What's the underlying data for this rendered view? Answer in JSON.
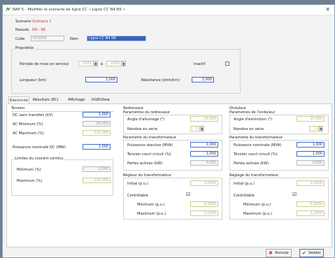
{
  "window": {
    "title": "NAP 5 - Modifier le scénario de ligne CC « Ligne CC N4 N5 »"
  },
  "header": {
    "scenario_label": "Scénario",
    "scenario_value": "Scénario 1",
    "noeuds_label": "Noeuds",
    "noeuds_value": "N4 - N5",
    "code_label": "Code",
    "code_value": "DC0001",
    "nom_label": "Nom",
    "nom_value": "Ligne CC N4 N5"
  },
  "props": {
    "title": "Propriétés",
    "periode_label": "Période de mise en service",
    "start_year": "2022",
    "sep": "à",
    "end_year": "2025",
    "inactif_label": "Inactif",
    "longueur_label": "Longueur (km)",
    "longueur_value": "1,000",
    "resistance_label": "Résistance (ohm/km)",
    "resistance_value": "1,000"
  },
  "tabs": [
    "Electricité",
    "Résultats (EC)",
    "Affichage",
    "ttGEtView"
  ],
  "tension": {
    "title": "Tension",
    "dc_label": "DC sans transfert (kV)",
    "dc_value": "1,000",
    "acmin_label": "AC Minimum (%)",
    "acmin_value": "90,000",
    "acmax_label": "AC Maximum (%)",
    "acmax_value": "110,000",
    "pnom_label": "Puissance nominale DC (MW)",
    "pnom_value": "1,000",
    "limites_title": "Limites du courant continu",
    "min_label": "Minimum (%)",
    "min_value": "0,000",
    "max_label": "Maximum (%)",
    "max_value": "110,000"
  },
  "redresseur": {
    "title": "Redresseur",
    "params_title": "Paramètres du redresseur",
    "angle_label": "Angle d'allumage (°)",
    "angle_value": "15,000",
    "nb_label": "Nombre en série",
    "nb_value": "1",
    "transfo_title": "Paramètre du transformateur",
    "preact_label": "Puissance réactive (MVA)",
    "preact_value": "1,000",
    "tcc_label": "Tension court circuit (%)",
    "tcc_value": "1,000",
    "pertes_label": "Pertes actives (kW)",
    "pertes_value": "0,000",
    "reglage_title": "Régleur du transformateur",
    "initial_label": "Initial (p.u.)",
    "initial_value": "1,0000",
    "ctrl_label": "Contrôlable",
    "ctrl_check": "☑",
    "min_label": "Minimum (p.u.)",
    "min_value": "0,9000",
    "max_label": "Maximum (p.u.)",
    "max_value": "1,1000"
  },
  "onduleur": {
    "title": "Onduleur",
    "params_title": "Paramètres de l'onduleur",
    "angle_label": "Angle d'extinction (°)",
    "angle_value": "15,000",
    "nb_label": "Nombre en série",
    "nb_value": "1",
    "transfo_title": "Paramètre du transformateur",
    "pnom_label": "Puissance nominale (MVA)",
    "pnom_value": "1,000",
    "tcc_label": "Tension court circuit (%)",
    "tcc_value": "1,000",
    "pertes_label": "Pertes actives (kW)",
    "pertes_value": "0,000",
    "reglage_title": "Réglage du transformateur",
    "initial_label": "Initial (p.u.)",
    "initial_value": "1,0000",
    "ctrl_label": "Contrôlable",
    "ctrl_check": "☑",
    "min_label": "Minimum (p.u.)",
    "min_value": "0,9000",
    "max_label": "Maximum (p.u.)",
    "max_value": "1,1000"
  },
  "buttons": {
    "cancel": "Annuler",
    "ok": "Valider"
  },
  "colors": {
    "accent": "#2f62d0",
    "red": "#c0392b",
    "green": "#2a8a2a"
  }
}
